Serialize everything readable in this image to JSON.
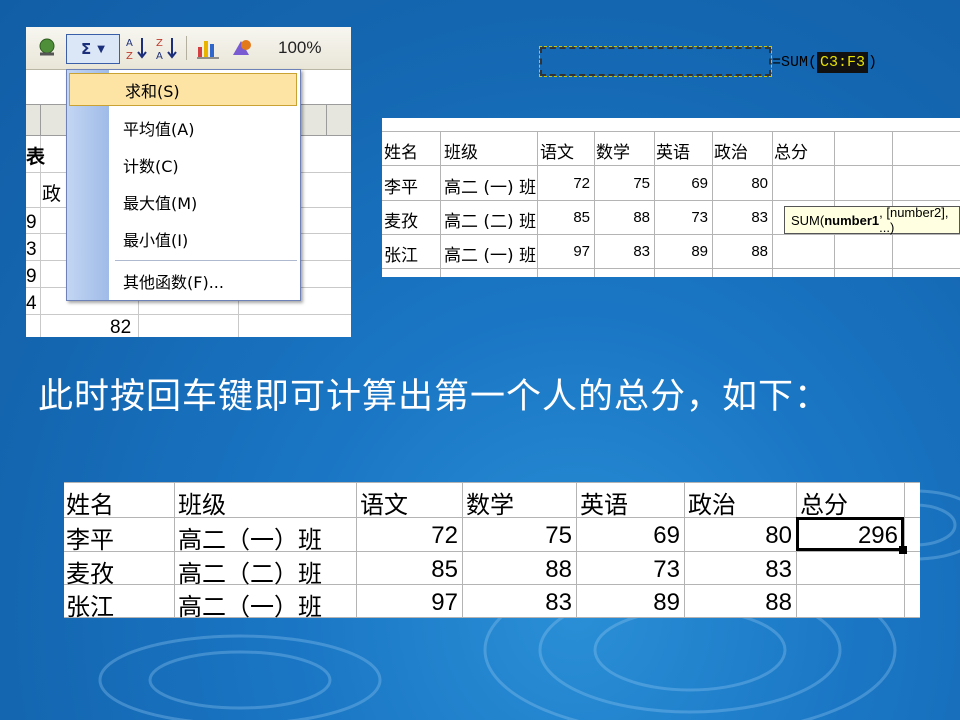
{
  "toolbar": {
    "sum_symbol": "Σ",
    "sort_asc": "A↓Z",
    "sort_desc": "Z↓A",
    "zoom": "100%"
  },
  "autosum_menu": {
    "items": [
      {
        "label": "求和(S)",
        "highlighted": true
      },
      {
        "label": "平均值(A)",
        "highlighted": false
      },
      {
        "label": "计数(C)",
        "highlighted": false
      },
      {
        "label": "最大值(M)",
        "highlighted": false
      },
      {
        "label": "最小值(I)",
        "highlighted": false
      },
      {
        "label": "其他函数(F)...",
        "highlighted": false
      }
    ]
  },
  "sheet1_partial": {
    "heading_fragment": "表",
    "col_header_fragment": "政",
    "row_fragments": [
      "9",
      "3",
      "9",
      "4"
    ],
    "value": "82"
  },
  "sheet2": {
    "headers": [
      "姓名",
      "班级",
      "语文",
      "数学",
      "英语",
      "政治",
      "总分"
    ],
    "rows": [
      {
        "name": "李平",
        "class": "高二 (一) 班",
        "scores": [
          "72",
          "75",
          "69",
          "80"
        ]
      },
      {
        "name": "麦孜",
        "class": "高二 (二) 班",
        "scores": [
          "85",
          "88",
          "73",
          "83"
        ]
      },
      {
        "name": "张江",
        "class": "高二 (一) 班",
        "scores": [
          "97",
          "83",
          "89",
          "88"
        ]
      }
    ],
    "formula_prefix": "=SUM(",
    "formula_ref": "C3:F3",
    "formula_suffix": ")",
    "tooltip_fn": "SUM(",
    "tooltip_bold": "number1",
    "tooltip_rest": ", [number2], ...)"
  },
  "caption": "此时按回车键即可计算出第一个人的总分，如下：",
  "sheet3": {
    "headers": [
      "姓名",
      "班级",
      "语文",
      "数学",
      "英语",
      "政治",
      "总分"
    ],
    "rows": [
      {
        "name": "李平",
        "class": "高二（一）班",
        "scores": [
          "72",
          "75",
          "69",
          "80"
        ],
        "total": "296"
      },
      {
        "name": "麦孜",
        "class": "高二（二）班",
        "scores": [
          "85",
          "88",
          "73",
          "83"
        ],
        "total": ""
      },
      {
        "name": "张江",
        "class": "高二（一）班",
        "scores": [
          "97",
          "83",
          "89",
          "88"
        ],
        "total": ""
      }
    ]
  },
  "colors": {
    "background": "#1466b0",
    "menu_highlight": "#fde4a5",
    "menu_strip": "#b3c9ee",
    "tooltip_bg": "#ffffe1",
    "ref_highlight": "#e5e000"
  }
}
